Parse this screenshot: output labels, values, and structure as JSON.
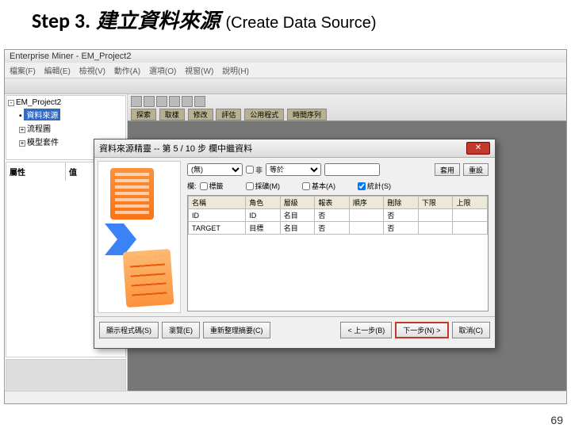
{
  "slide": {
    "step": "Step 3.",
    "title_cn": "建立資料來源",
    "title_en": "(Create Data Source)",
    "page": "69"
  },
  "app": {
    "title": "Enterprise Miner - EM_Project2",
    "menu": [
      "檔案(F)",
      "編輯(E)",
      "檢視(V)",
      "動作(A)",
      "選項(O)",
      "視窗(W)",
      "說明(H)"
    ],
    "tree": {
      "root": "EM_Project2",
      "items": [
        "資料來源",
        "流程圖",
        "模型套件"
      ],
      "selected": "資料來源"
    },
    "prop": {
      "col1": "屬性",
      "col2": "值"
    },
    "tabs": [
      "探索",
      "取樣",
      "修改",
      "評估",
      "公用程式",
      "時間序列"
    ]
  },
  "wizard": {
    "title": "資料來源精靈 -- 第 5 / 10 步 欄中繼資料",
    "row1": {
      "dd1_label": "(無)",
      "eq": "等於",
      "dd2_label": "",
      "apply": "套用",
      "reset": "重設"
    },
    "row2": {
      "cols_label": "欄:",
      "chk_label": "標籤",
      "chk_mining": "採礦(M)",
      "chk_basic": "基本(A)",
      "chk_stats": "統計(S)"
    },
    "grid": {
      "headers": [
        "名稱",
        "角色",
        "層級",
        "報表",
        "順序",
        "刪除",
        "下限",
        "上限"
      ],
      "rows": [
        {
          "name": "ID",
          "role": "ID",
          "level": "名目",
          "report": "否",
          "order": "",
          "delete": "否",
          "lo": "",
          "hi": ""
        },
        {
          "name": "TARGET",
          "role": "目標",
          "level": "名目",
          "report": "否",
          "order": "",
          "delete": "否",
          "lo": "",
          "hi": ""
        }
      ]
    },
    "foot": {
      "show_code": "顯示程式碼(S)",
      "explore": "瀏覽(E)",
      "edit_vars": "重新整理摘要(C)",
      "back": "< 上一步(B)",
      "next": "下一步(N) >",
      "cancel": "取消(C)"
    }
  }
}
